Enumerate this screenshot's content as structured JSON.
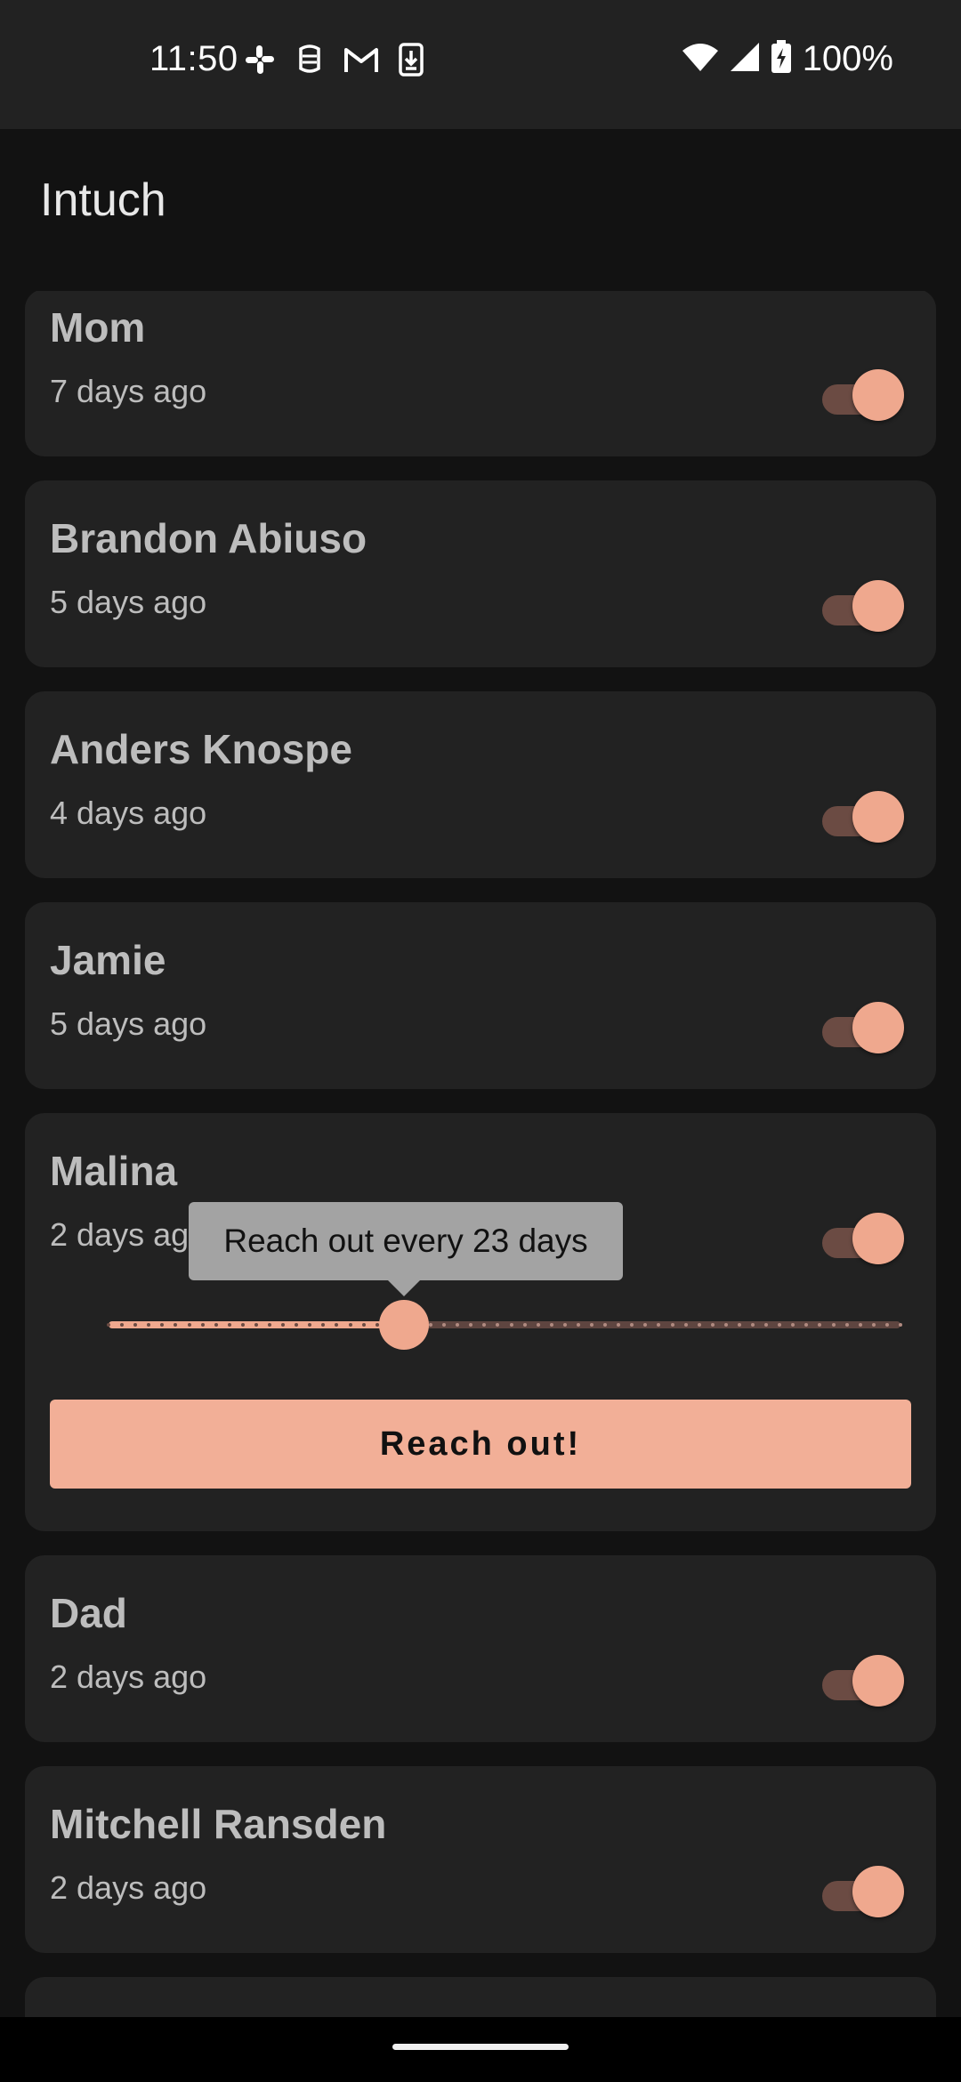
{
  "status_bar": {
    "time": "11:50",
    "left_icons": [
      "slack-icon",
      "notification-icon",
      "gmail-icon",
      "download-icon"
    ],
    "right_icons": [
      "wifi-icon",
      "cellular-icon",
      "battery-charging-icon"
    ],
    "battery": "100%"
  },
  "app": {
    "title": "Intuch"
  },
  "contacts": [
    {
      "name": "Mom",
      "last_contact": "7 days ago",
      "enabled": true
    },
    {
      "name": "Brandon Abiuso",
      "last_contact": "5 days ago",
      "enabled": true
    },
    {
      "name": "Anders Knospe",
      "last_contact": "4 days ago",
      "enabled": true
    },
    {
      "name": "Jamie",
      "last_contact": "5 days ago",
      "enabled": true
    },
    {
      "name": "Malina",
      "last_contact": "2 days ago",
      "enabled": true,
      "expanded": true
    },
    {
      "name": "Dad",
      "last_contact": "2 days ago",
      "enabled": true
    },
    {
      "name": "Mitchell Ransden",
      "last_contact": "2 days ago",
      "enabled": true
    },
    {
      "name": "",
      "last_contact": "",
      "enabled": true
    }
  ],
  "expanded_card": {
    "tooltip": "Reach out every 23 days",
    "slider": {
      "value": 23,
      "min": 1,
      "max": 60
    },
    "button_label": "Reach out!"
  },
  "colors": {
    "accent": "#efa88e",
    "card_bg": "#222222",
    "background": "#121212",
    "track_inactive": "#5e4540"
  }
}
